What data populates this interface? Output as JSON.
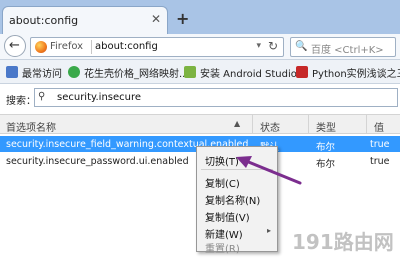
{
  "tab": {
    "title": "about:config"
  },
  "nav": {
    "brand": "Firefox",
    "url": "about:config",
    "search_placeholder": "百度 <Ctrl+K>"
  },
  "bookmarks": [
    {
      "label": "最常访问",
      "icon": "gear-icon",
      "color": "#4a78c9"
    },
    {
      "label": "花生壳价格_网络映射...",
      "icon": "peanut-icon",
      "color": "#3aa94a"
    },
    {
      "label": "安装 Android Studio...",
      "icon": "android-icon",
      "color": "#7cb342"
    },
    {
      "label": "Python实例浅谈之三...",
      "icon": "csdn-icon",
      "color": "#c62828"
    }
  ],
  "search": {
    "label": "搜索：",
    "value": "security.insecure"
  },
  "table": {
    "headers": {
      "name": "首选项名称",
      "status": "状态",
      "type": "类型",
      "value": "值"
    },
    "rows": [
      {
        "name": "security.insecure_field_warning.contextual.enabled",
        "status": "默认",
        "type": "布尔",
        "value": "true",
        "selected": true
      },
      {
        "name": "security.insecure_password.ui.enabled",
        "status": "",
        "type": "布尔",
        "value": "true",
        "selected": false
      }
    ]
  },
  "context_menu": {
    "items": [
      {
        "label": "切换(T)",
        "enabled": true
      },
      {
        "label": "复制(C)",
        "enabled": true
      },
      {
        "label": "复制名称(N)",
        "enabled": true
      },
      {
        "label": "复制值(V)",
        "enabled": true
      },
      {
        "label": "新建(W)",
        "enabled": true,
        "submenu": true
      },
      {
        "label": "重置(R)",
        "enabled": false
      }
    ]
  },
  "watermark": "191路由网",
  "colors": {
    "selection": "#3399ff",
    "annotation_arrow": "#7b2d8e",
    "tabstrip": "#a9c4e6"
  }
}
